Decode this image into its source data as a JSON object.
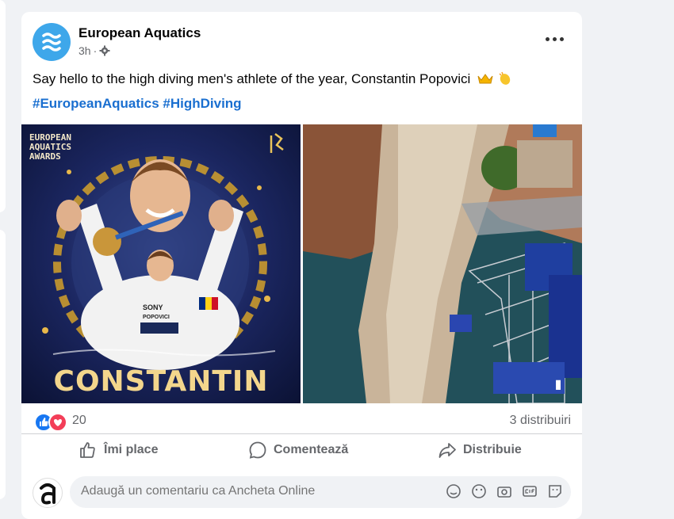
{
  "post": {
    "author": "European Aquatics",
    "time": "3h",
    "privacy_icon": "gear-icon",
    "text": "Say hello to the high diving men's athlete of the year, Constantin Popovici",
    "emojis": [
      "crown-emoji",
      "clapping-hands-emoji"
    ],
    "hashtags": [
      "#EuropeanAquatics",
      "#HighDiving"
    ],
    "image1": {
      "brand_lines": [
        "EUROPEAN",
        "AQUATICS",
        "AWARDS"
      ],
      "name": "CONSTANTIN",
      "shirt_text": [
        "SONY",
        "POPOVICI"
      ]
    },
    "reactions": {
      "count": "20",
      "types": [
        "like-icon",
        "love-icon"
      ]
    },
    "shares": "3 distribuiri",
    "actions": {
      "like": "Îmi place",
      "comment": "Comentează",
      "share": "Distribuie"
    },
    "comment_placeholder": "Adaugă un comentariu ca Ancheta Online",
    "comment_icons": [
      "sticker-icon",
      "emoji-icon",
      "camera-icon",
      "gif-icon",
      "sticker-square-icon"
    ]
  },
  "colors": {
    "accent": "#1a6fd0",
    "avatar_bg": "#3ea7ea",
    "like": "#1877f2",
    "love": "#f33e58"
  }
}
